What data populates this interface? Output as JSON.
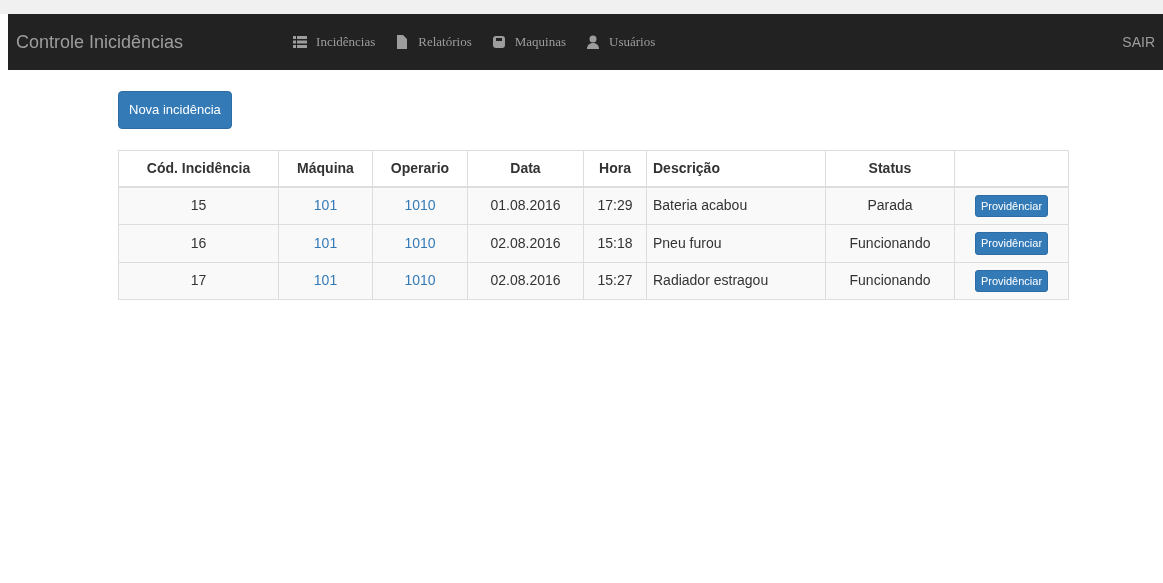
{
  "navbar": {
    "brand": "Controle Inicidências",
    "items": [
      {
        "label": "Incidências"
      },
      {
        "label": "Relatórios"
      },
      {
        "label": "Maquinas"
      },
      {
        "label": "Usuários"
      }
    ],
    "logout": "SAIR"
  },
  "new_button": "Nova incidência",
  "table": {
    "columns": [
      "Cód. Incidência",
      "Máquina",
      "Operario",
      "Data",
      "Hora",
      "Descrição",
      "Status"
    ],
    "rows": [
      {
        "code": "15",
        "machine": "101",
        "operator": "1010",
        "date": "01.08.2016",
        "time": "17:29",
        "description": "Bateria acabou",
        "status": "Parada",
        "action": "Providênciar"
      },
      {
        "code": "16",
        "machine": "101",
        "operator": "1010",
        "date": "02.08.2016",
        "time": "15:18",
        "description": "Pneu furou",
        "status": "Funcionando",
        "action": "Providênciar"
      },
      {
        "code": "17",
        "machine": "101",
        "operator": "1010",
        "date": "02.08.2016",
        "time": "15:27",
        "description": "Radiador estragou",
        "status": "Funcionando",
        "action": "Providênciar"
      }
    ]
  }
}
